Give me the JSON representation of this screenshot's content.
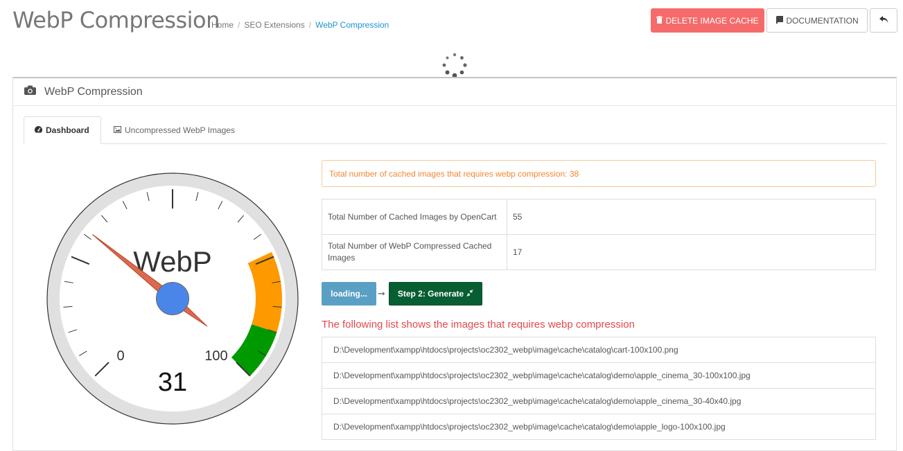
{
  "header": {
    "title": "WebP Compression",
    "breadcrumb": [
      "Home",
      "SEO Extensions",
      "WebP Compression"
    ],
    "delete_cache_label": "DELETE IMAGE CACHE",
    "documentation_label": "DOCUMENTATION"
  },
  "panel": {
    "title": "WebP Compression",
    "tabs": [
      {
        "label": "Dashboard",
        "icon": "dashboard-icon",
        "active": true
      },
      {
        "label": "Uncompressed WebP Images",
        "icon": "image-icon",
        "active": false
      }
    ]
  },
  "gauge": {
    "label": "WebP",
    "value": 31,
    "min_label": "0",
    "max_label": "100",
    "colors": {
      "green": "#009900",
      "orange": "#ff9900",
      "needle": "#dc6a4d",
      "hub": "#4a86e8"
    }
  },
  "dashboard": {
    "alert": "Total number of cached images that requires webp compression: 38",
    "stats": [
      {
        "label": "Total Number of Cached Images by OpenCart",
        "value": "55"
      },
      {
        "label": "Total Number of WebP Compressed Cached Images",
        "value": "17"
      }
    ],
    "loading_label": "loading...",
    "generate_label": "Step 2: Generate",
    "list_heading": "The following list shows the images that requires webp compression",
    "files": [
      "D:\\Development\\xampp\\htdocs\\projects\\oc2302_webp\\image\\cache\\catalog\\cart-100x100.png",
      "D:\\Development\\xampp\\htdocs\\projects\\oc2302_webp\\image\\cache\\catalog\\demo\\apple_cinema_30-100x100.jpg",
      "D:\\Development\\xampp\\htdocs\\projects\\oc2302_webp\\image\\cache\\catalog\\demo\\apple_cinema_30-40x40.jpg",
      "D:\\Development\\xampp\\htdocs\\projects\\oc2302_webp\\image\\cache\\catalog\\demo\\apple_logo-100x100.jpg"
    ]
  },
  "colors": {
    "danger": "#f56b6b",
    "link": "#1e91cf",
    "warning_text": "#f38733",
    "heading_red": "#e6474d",
    "btn_info": "#5aa0c4",
    "btn_success": "#075e33"
  }
}
